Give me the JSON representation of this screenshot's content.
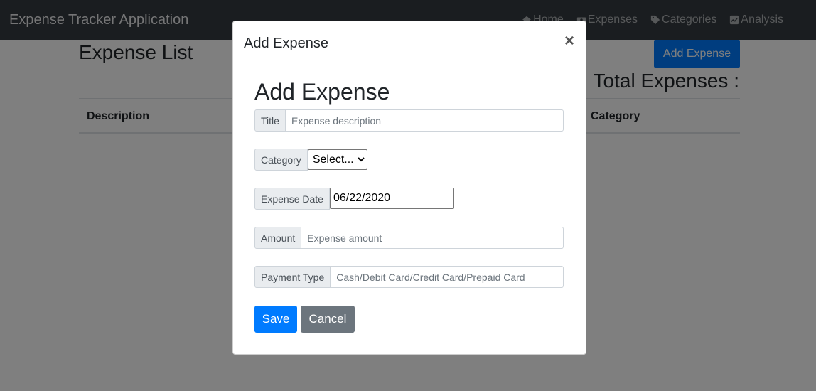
{
  "navbar": {
    "brand": "Expense Tracker Application",
    "links": [
      {
        "label": "Home",
        "icon": "home-icon"
      },
      {
        "label": "Expenses",
        "icon": "money-icon"
      },
      {
        "label": "Categories",
        "icon": "tag-icon"
      },
      {
        "label": "Analysis",
        "icon": "chart-icon"
      }
    ]
  },
  "page": {
    "title": "Expense List",
    "add_button": "Add Expense",
    "total_label": "Total Expenses :",
    "columns": {
      "description": "Description",
      "category": "Category"
    }
  },
  "modal": {
    "title": "Add Expense",
    "close": "×",
    "heading": "Add Expense",
    "fields": {
      "title": {
        "label": "Title",
        "placeholder": "Expense description"
      },
      "category": {
        "label": "Category",
        "selected": "Select..."
      },
      "date": {
        "label": "Expense Date",
        "value": "06/22/2020"
      },
      "amount": {
        "label": "Amount",
        "placeholder": "Expense amount"
      },
      "payment": {
        "label": "Payment Type",
        "placeholder": "Cash/Debit Card/Credit Card/Prepaid Card"
      }
    },
    "save": "Save",
    "cancel": "Cancel"
  },
  "colors": {
    "navbar": "#343a40",
    "primary": "#007bff",
    "secondary": "#6c757d"
  }
}
